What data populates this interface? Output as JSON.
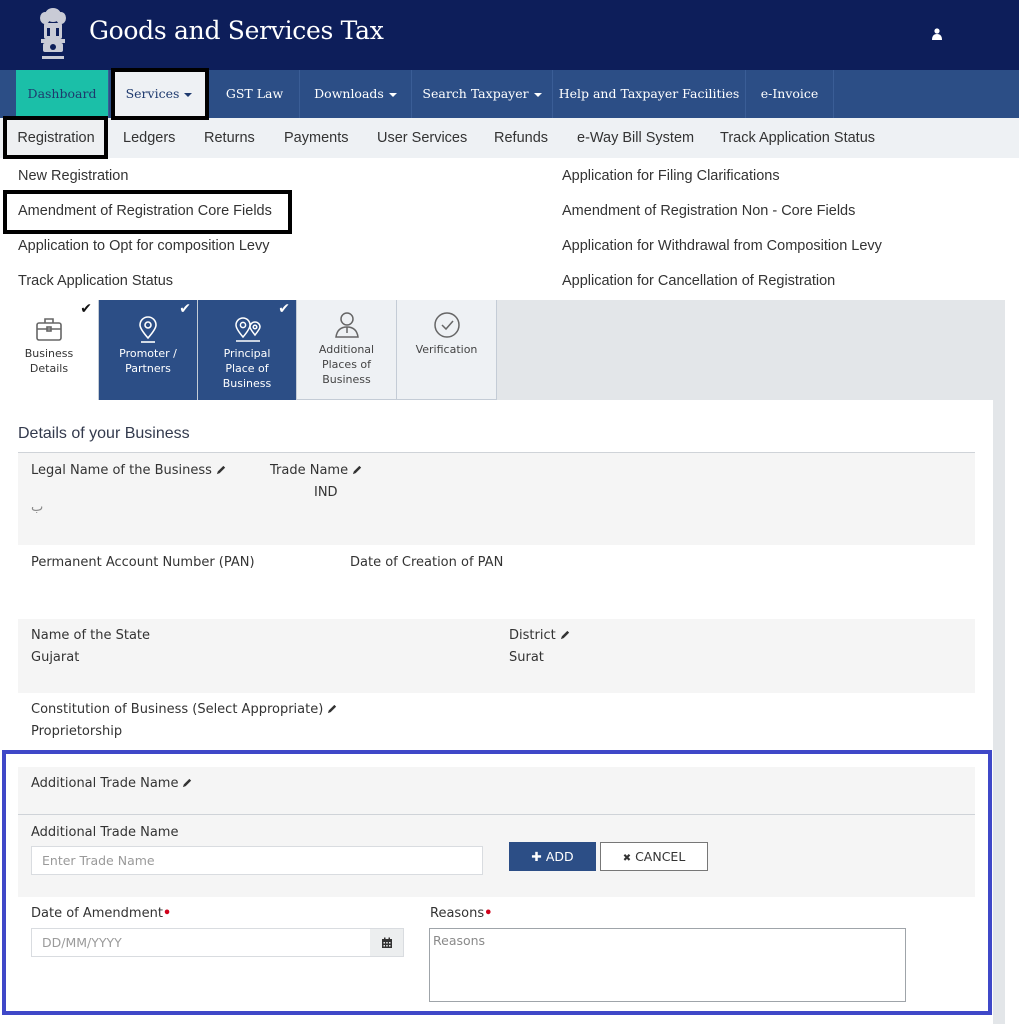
{
  "header": {
    "title": "Goods and Services Tax",
    "emblem_icon": "national-emblem-icon",
    "user_icon": "user-icon"
  },
  "main_nav": {
    "items": [
      {
        "label": "Dashboard",
        "has_caret": false
      },
      {
        "label": "Services",
        "has_caret": true
      },
      {
        "label": "GST Law",
        "has_caret": false
      },
      {
        "label": "Downloads",
        "has_caret": true
      },
      {
        "label": "Search Taxpayer",
        "has_caret": true
      },
      {
        "label": "Help and Taxpayer Facilities",
        "has_caret": false
      },
      {
        "label": "e-Invoice",
        "has_caret": false
      }
    ]
  },
  "sub_nav": {
    "items": [
      {
        "label": "Registration"
      },
      {
        "label": "Ledgers"
      },
      {
        "label": "Returns"
      },
      {
        "label": "Payments"
      },
      {
        "label": "User Services"
      },
      {
        "label": "Refunds"
      },
      {
        "label": "e-Way Bill System"
      },
      {
        "label": "Track Application Status"
      }
    ]
  },
  "registration_menu": {
    "left": [
      {
        "label": "New Registration"
      },
      {
        "label": "Amendment of Registration Core Fields"
      },
      {
        "label": "Application to Opt for composition Levy"
      },
      {
        "label": "Track Application Status"
      }
    ],
    "right": [
      {
        "label": "Application for Filing Clarifications"
      },
      {
        "label": "Amendment of Registration Non - Core Fields"
      },
      {
        "label": "Application for Withdrawal from Composition Levy"
      },
      {
        "label": "Application for Cancellation of Registration"
      }
    ]
  },
  "wizard": {
    "steps": [
      {
        "label_lines": [
          "Business",
          "Details"
        ],
        "icon": "briefcase-icon",
        "completed": true
      },
      {
        "label_lines": [
          "Promoter /",
          "Partners"
        ],
        "icon": "location-pin-icon",
        "completed": true
      },
      {
        "label_lines": [
          "Principal",
          "Place of",
          "Business"
        ],
        "icon": "double-location-pin-icon",
        "completed": true
      },
      {
        "label_lines": [
          "Additional",
          "Places of",
          "Business"
        ],
        "icon": "person-icon",
        "completed": false
      },
      {
        "label_lines": [
          "Verification"
        ],
        "icon": "check-circle-icon",
        "completed": false
      }
    ],
    "check_glyph": "✔"
  },
  "details": {
    "section_title": "Details of your Business",
    "legal_name_label": "Legal Name of the Business",
    "legal_name_value": "ب",
    "trade_name_label": "Trade Name",
    "trade_name_value": "IND",
    "pan_label": "Permanent Account Number (PAN)",
    "pan_date_label": "Date of Creation of PAN",
    "state_label": "Name of the State",
    "state_value": "Gujarat",
    "district_label": "District",
    "district_value": "Surat",
    "constitution_label": "Constitution of Business (Select Appropriate)",
    "constitution_value": "Proprietorship"
  },
  "amendment": {
    "additional_trade_name_heading": "Additional Trade Name",
    "additional_trade_name_label": "Additional Trade Name",
    "trade_name_placeholder": "Enter Trade Name",
    "add_button": "ADD",
    "add_glyph": "✚",
    "cancel_button": "CANCEL",
    "cancel_glyph": "✖",
    "date_label": "Date of Amendment",
    "date_placeholder": "DD/MM/YYYY",
    "reasons_label": "Reasons",
    "reasons_placeholder": "Reasons",
    "required_marker": "•"
  },
  "colors": {
    "header_bg": "#0d1e5a",
    "nav_bg": "#2c4e86",
    "dashboard_accent": "#1bbfa8",
    "highlight_box_blue": "#3f48c8",
    "required_red": "#d0021b"
  }
}
